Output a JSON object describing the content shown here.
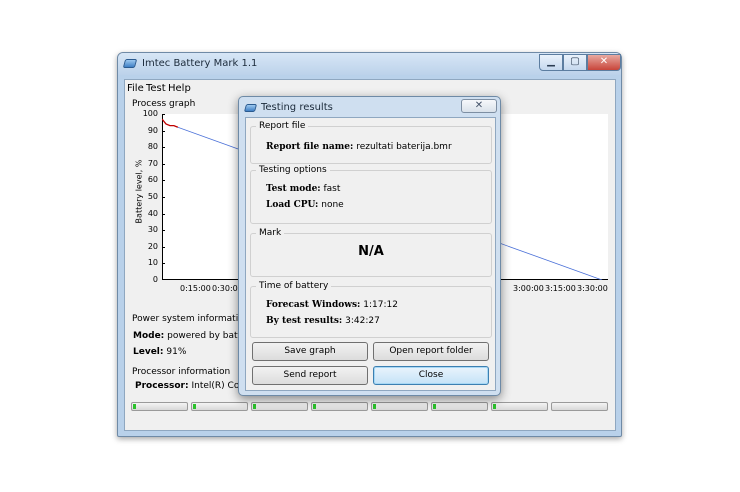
{
  "window": {
    "title": "Imtec Battery Mark 1.1",
    "controls": {
      "minimize": "▁",
      "maximize": "▢",
      "close": "✕"
    }
  },
  "menu": [
    "File",
    "Test",
    "Help"
  ],
  "graph": {
    "group_label": "Process graph",
    "y_label": "Battery level, %",
    "y_ticks": [
      "100",
      "90",
      "80",
      "70",
      "60",
      "50",
      "40",
      "30",
      "20",
      "10",
      "0"
    ],
    "x_ticks_left": [
      "0:15:00",
      "0:30:00"
    ],
    "x_ticks_right": [
      "3:00:00",
      "3:15:00",
      "3:30:00"
    ]
  },
  "chart_data": {
    "type": "line",
    "ylabel": "Battery level, %",
    "ylim": [
      0,
      100
    ],
    "xlim_minutes": [
      0,
      225
    ],
    "series": [
      {
        "x_minutes": [
          0,
          2,
          4,
          6,
          8
        ],
        "values": [
          97,
          94,
          93,
          93,
          92
        ],
        "color": "#c00000"
      },
      {
        "x_minutes": [
          8,
          222
        ],
        "values": [
          92,
          0
        ],
        "color": "#4a70d8"
      }
    ]
  },
  "power": {
    "group_label": "Power system information",
    "mode_label": "Mode:",
    "mode_value": "powered by battery",
    "level_label": "Level:",
    "level_value": "91%"
  },
  "processor": {
    "group_label": "Processor information",
    "processor_label": "Processor:",
    "processor_value": "Intel(R) Core(T",
    "cores_fill": [
      0.06,
      0.06,
      0.06,
      0.06,
      0.06,
      0.06,
      0.06,
      0.0
    ]
  },
  "dialog": {
    "title": "Testing results",
    "close": "✕",
    "report_file": {
      "group": "Report file",
      "name_label": "Report file name:",
      "name_value": "rezultati baterija.bmr"
    },
    "testing_options": {
      "group": "Testing options",
      "mode_label": "Test mode:",
      "mode_value": "fast",
      "cpu_label": "Load CPU:",
      "cpu_value": "none"
    },
    "mark": {
      "group": "Mark",
      "value": "N/A"
    },
    "time": {
      "group": "Time of battery",
      "forecast_label": "Forecast Windows:",
      "forecast_value": "1:17:12",
      "results_label": "By test results:",
      "results_value": "3:42:27"
    },
    "buttons": {
      "save_graph": "Save graph",
      "open_folder": "Open report folder",
      "send_report": "Send report",
      "close": "Close"
    }
  }
}
